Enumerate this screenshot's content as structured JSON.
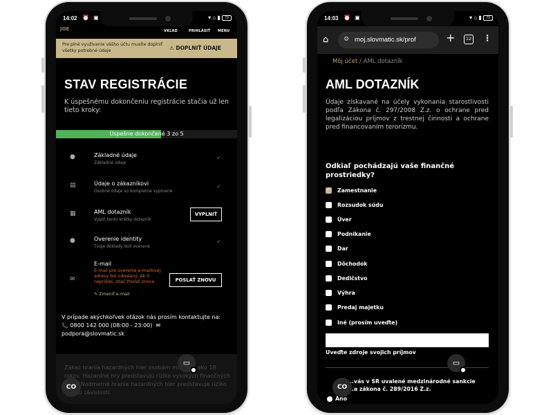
{
  "left": {
    "status": {
      "time": "14:02",
      "icons": "⏰ ▣",
      "right": "▾ ⌂ ▮",
      "battery": "73"
    },
    "header": {
      "logo_fragment": "JOE",
      "nav_deposit": "VKLAD",
      "nav_login": "PRIHLÁSIŤ",
      "nav_menu": "MENU"
    },
    "banner": {
      "text": "Pre plné využívanie vášho účtu musíte doplniť všetky potrebné údaje",
      "button": "⚠ DOPLNIŤ ÚDAJE"
    },
    "title": "STAV REGISTRÁCIE",
    "intro": "K úspešnému dokončeniu registrácie stačia už len tieto kroky:",
    "progress": {
      "text": "Úspešne dokončené 3 zo 5",
      "completed": 3,
      "total": 5
    },
    "steps": [
      {
        "name": "Základné údaje",
        "sub": "Základné údaje",
        "check": "✓"
      },
      {
        "name": "Údaje o zákazníkovi",
        "sub": "Osobné údaje sú kompletne vyplnené",
        "check": "✓"
      },
      {
        "name": "AML dotazník",
        "sub": "Vyplň tento krátky dotazník",
        "action": "VYPLNIŤ"
      },
      {
        "name": "Overenie identity",
        "sub": "Tvoje doklady boli overené",
        "check": "✓"
      },
      {
        "name": "E-mail",
        "error": "E-mail pre overenie e-mailovej adresy bol odoslaný. Ak ti neprišiel, stlač Poslať znova",
        "link": "✎ Zmeniť e-mail",
        "action": "POSLAŤ ZNOVU"
      }
    ],
    "contact": {
      "text": "V prípade akýchkoľvek otázok nás prosím kontaktujte na:",
      "phone": "0800 142 000 (08:00 - 23:00)",
      "email": "podpora@slovmatic.sk"
    },
    "footer": "Zákaz hrania hazardných hier osobám mladším ako 18 rokov. Hazardné hry predstavujú riziko vysokých finančných strát. Nadmerné hranie hazardných hier predstavuje riziko vzniku závislosti.",
    "bubble": "CO"
  },
  "right": {
    "status": {
      "time": "14:03",
      "icons": "⏰ ▣",
      "right": "▾ ⌂ ▮",
      "battery": "73"
    },
    "browser": {
      "url": "moj.slovmatic.sk/prof",
      "tabs": "12"
    },
    "breadcrumb": {
      "home": "Môj účet",
      "sep": " / ",
      "current": "AML dotazník"
    },
    "title": "AML DOTAZNÍK",
    "intro": "Údaje získavané na účely vykonania starostlivosti podľa Zákona č. 297/2008 Z.z. o ochrane pred legalizáciou príjmov z trestnej činnosti a ochrane pred financovaním terorizmu.",
    "question": "Odkiaľ pochádzajú vaše finančné prostriedky?",
    "options": [
      "Zamestnanie",
      "Rozsudok súdu",
      "Úver",
      "Podnikanie",
      "Dar",
      "Dôchodok",
      "Dedičstvo",
      "Výhra",
      "Predaj majetku",
      "Iné (prosím uveďte)"
    ],
    "checked_index": 0,
    "source_label": "Uveďte zdroje svojich príjmov",
    "sanctions": "...vás v SR uvalené medzinárodné sankcie ...a zákona č. 289/2016 Z.z.",
    "answer_yes": "Áno",
    "bubble": "CO"
  },
  "colors": {
    "accent_gold": "#c9b98a",
    "success": "#52b156",
    "error": "#e2672a"
  }
}
